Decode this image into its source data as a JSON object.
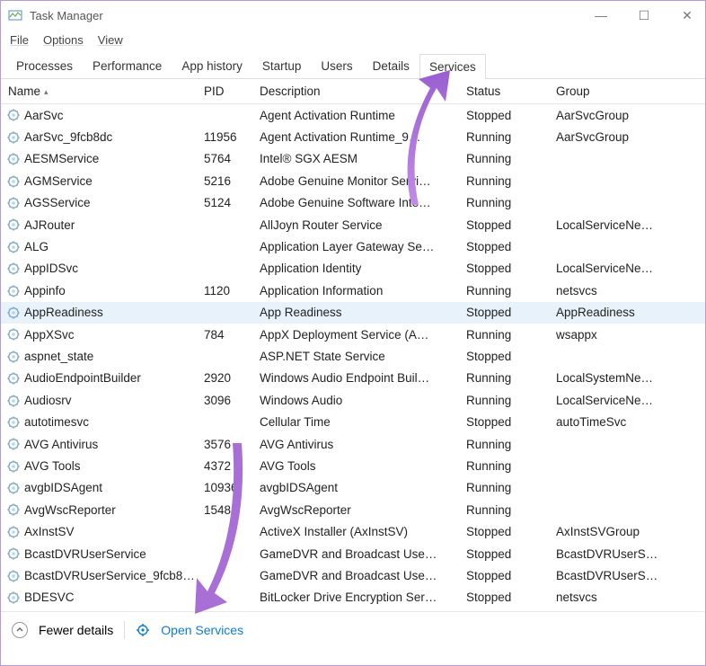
{
  "window": {
    "title": "Task Manager"
  },
  "menu": {
    "file": "File",
    "options": "Options",
    "view": "View"
  },
  "tabs": {
    "processes": "Processes",
    "performance": "Performance",
    "apphistory": "App history",
    "startup": "Startup",
    "users": "Users",
    "details": "Details",
    "services": "Services"
  },
  "columns": {
    "name": "Name",
    "pid": "PID",
    "description": "Description",
    "status": "Status",
    "group": "Group"
  },
  "selected_row_index": 9,
  "services": [
    {
      "name": "AarSvc",
      "pid": "",
      "desc": "Agent Activation Runtime",
      "status": "Stopped",
      "group": "AarSvcGroup"
    },
    {
      "name": "AarSvc_9fcb8dc",
      "pid": "11956",
      "desc": "Agent Activation Runtime_9…",
      "status": "Running",
      "group": "AarSvcGroup"
    },
    {
      "name": "AESMService",
      "pid": "5764",
      "desc": "Intel® SGX AESM",
      "status": "Running",
      "group": ""
    },
    {
      "name": "AGMService",
      "pid": "5216",
      "desc": "Adobe Genuine Monitor Servi…",
      "status": "Running",
      "group": ""
    },
    {
      "name": "AGSService",
      "pid": "5124",
      "desc": "Adobe Genuine Software Inte…",
      "status": "Running",
      "group": ""
    },
    {
      "name": "AJRouter",
      "pid": "",
      "desc": "AllJoyn Router Service",
      "status": "Stopped",
      "group": "LocalServiceNe…"
    },
    {
      "name": "ALG",
      "pid": "",
      "desc": "Application Layer Gateway Se…",
      "status": "Stopped",
      "group": ""
    },
    {
      "name": "AppIDSvc",
      "pid": "",
      "desc": "Application Identity",
      "status": "Stopped",
      "group": "LocalServiceNe…"
    },
    {
      "name": "Appinfo",
      "pid": "1120",
      "desc": "Application Information",
      "status": "Running",
      "group": "netsvcs"
    },
    {
      "name": "AppReadiness",
      "pid": "",
      "desc": "App Readiness",
      "status": "Stopped",
      "group": "AppReadiness"
    },
    {
      "name": "AppXSvc",
      "pid": "784",
      "desc": "AppX Deployment Service (A…",
      "status": "Running",
      "group": "wsappx"
    },
    {
      "name": "aspnet_state",
      "pid": "",
      "desc": "ASP.NET State Service",
      "status": "Stopped",
      "group": ""
    },
    {
      "name": "AudioEndpointBuilder",
      "pid": "2920",
      "desc": "Windows Audio Endpoint Buil…",
      "status": "Running",
      "group": "LocalSystemNe…"
    },
    {
      "name": "Audiosrv",
      "pid": "3096",
      "desc": "Windows Audio",
      "status": "Running",
      "group": "LocalServiceNe…"
    },
    {
      "name": "autotimesvc",
      "pid": "",
      "desc": "Cellular Time",
      "status": "Stopped",
      "group": "autoTimeSvc"
    },
    {
      "name": "AVG Antivirus",
      "pid": "3576",
      "desc": "AVG Antivirus",
      "status": "Running",
      "group": ""
    },
    {
      "name": "AVG Tools",
      "pid": "4372",
      "desc": "AVG Tools",
      "status": "Running",
      "group": ""
    },
    {
      "name": "avgbIDSAgent",
      "pid": "10936",
      "desc": "avgbIDSAgent",
      "status": "Running",
      "group": ""
    },
    {
      "name": "AvgWscReporter",
      "pid": "1548",
      "desc": "AvgWscReporter",
      "status": "Running",
      "group": ""
    },
    {
      "name": "AxInstSV",
      "pid": "",
      "desc": "ActiveX Installer (AxInstSV)",
      "status": "Stopped",
      "group": "AxInstSVGroup"
    },
    {
      "name": "BcastDVRUserService",
      "pid": "",
      "desc": "GameDVR and Broadcast Use…",
      "status": "Stopped",
      "group": "BcastDVRUserS…"
    },
    {
      "name": "BcastDVRUserService_9fcb8…",
      "pid": "",
      "desc": "GameDVR and Broadcast Use…",
      "status": "Stopped",
      "group": "BcastDVRUserS…"
    },
    {
      "name": "BDESVC",
      "pid": "",
      "desc": "BitLocker Drive Encryption Ser…",
      "status": "Stopped",
      "group": "netsvcs"
    }
  ],
  "footer": {
    "fewer": "Fewer details",
    "open_services": "Open Services"
  }
}
